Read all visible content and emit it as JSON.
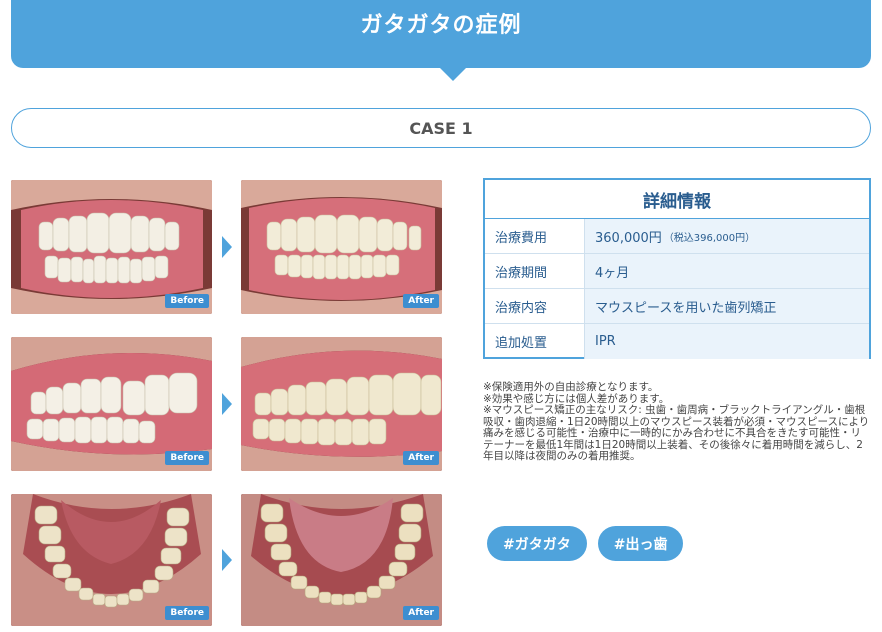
{
  "header": {
    "title": "ガタガタの症例"
  },
  "case": {
    "label": "CASE 1"
  },
  "photos": {
    "before_label": "Before",
    "after_label": "After"
  },
  "details": {
    "title": "詳細情報",
    "rows": [
      {
        "key": "治療費用",
        "value": "360,000円",
        "note": "（税込396,000円）"
      },
      {
        "key": "治療期間",
        "value": "4ヶ月",
        "note": ""
      },
      {
        "key": "治療内容",
        "value": "マウスピースを用いた歯列矯正",
        "note": ""
      },
      {
        "key": "追加処置",
        "value": "IPR",
        "note": ""
      }
    ]
  },
  "notes": [
    "※保険適用外の自由診療となります。",
    "※効果や感じ方には個人差があります。",
    "※マウスピース矯正の主なリスク: 虫歯・歯周病・ブラックトライアングル・歯根吸収・歯肉退縮・1日20時間以上のマウスピース装着が必須・マウスピースにより痛みを感じる可能性・治療中に一時的にかみ合わせに不具合をきたす可能性・リテーナーを最低1年間は1日20時間以上装着、その後徐々に着用時間を減らし、2年目以降は夜間のみの着用推奨。"
  ],
  "hashtags": [
    "#ガタガタ",
    "#出っ歯"
  ],
  "colors": {
    "accent": "#4fa3dc",
    "text_blue": "#2a5d8f",
    "cell_bg": "#eaf3fb"
  }
}
